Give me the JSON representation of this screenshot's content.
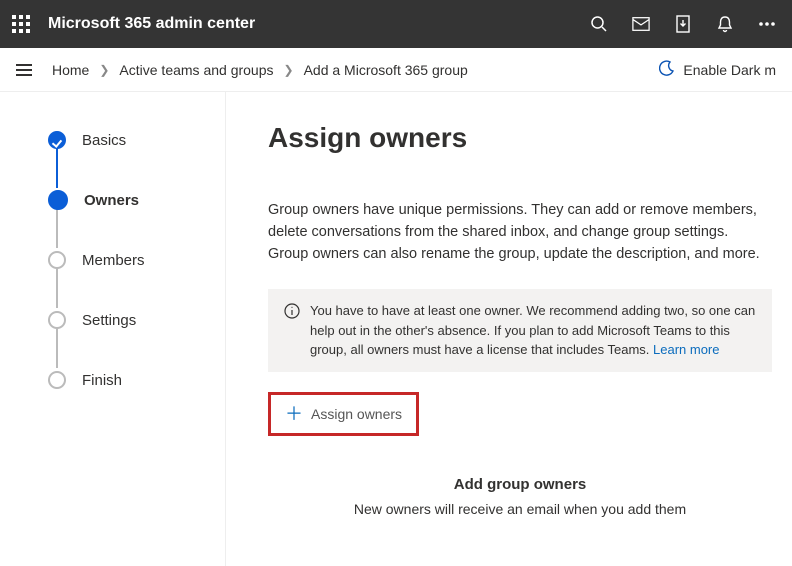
{
  "header": {
    "app_title": "Microsoft 365 admin center"
  },
  "breadcrumb": {
    "items": [
      "Home",
      "Active teams and groups",
      "Add a Microsoft 365 group"
    ],
    "dark_mode_label": "Enable Dark m"
  },
  "wizard": {
    "steps": [
      {
        "label": "Basics",
        "state": "done"
      },
      {
        "label": "Owners",
        "state": "active"
      },
      {
        "label": "Members",
        "state": "pending"
      },
      {
        "label": "Settings",
        "state": "pending"
      },
      {
        "label": "Finish",
        "state": "pending"
      }
    ]
  },
  "content": {
    "heading": "Assign owners",
    "description": "Group owners have unique permissions. They can add or remove members, delete conversations from the shared inbox, and change group settings. Group owners can also rename the group, update the description, and more.",
    "info_text": "You have to have at least one owner. We recommend adding two, so one can help out in the other's absence. If you plan to add Microsoft Teams to this group, all owners must have a license that includes Teams. ",
    "info_link": "Learn more",
    "assign_button": "Assign owners",
    "add_owners_title": "Add group owners",
    "add_owners_sub": "New owners will receive an email when you add them"
  }
}
